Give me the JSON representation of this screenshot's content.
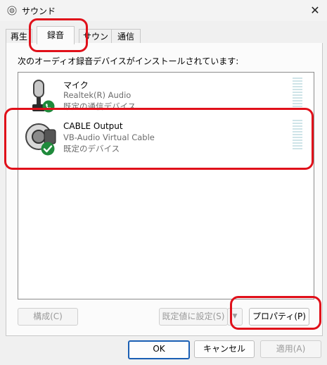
{
  "window": {
    "title": "サウンド",
    "close_glyph": "✕"
  },
  "tabs": [
    {
      "label": "再生"
    },
    {
      "label": "録音"
    },
    {
      "label": "サウンド"
    },
    {
      "label": "通信"
    }
  ],
  "panel": {
    "description": "次のオーディオ録音デバイスがインストールされています:"
  },
  "devices": [
    {
      "name": "マイク",
      "driver": "Realtek(R) Audio",
      "status": "既定の通信デバイス"
    },
    {
      "name": "CABLE Output",
      "driver": "VB-Audio Virtual Cable",
      "status": "既定のデバイス"
    }
  ],
  "buttons": {
    "configure": "構成(C)",
    "set_default": "既定値に設定(S)",
    "properties": "プロパティ(P)",
    "ok": "OK",
    "cancel": "キャンセル",
    "apply": "適用(A)"
  },
  "colors": {
    "accent": "#1a5fb4",
    "check_green": "#1f8a3b",
    "highlight_red": "#e0101a"
  }
}
